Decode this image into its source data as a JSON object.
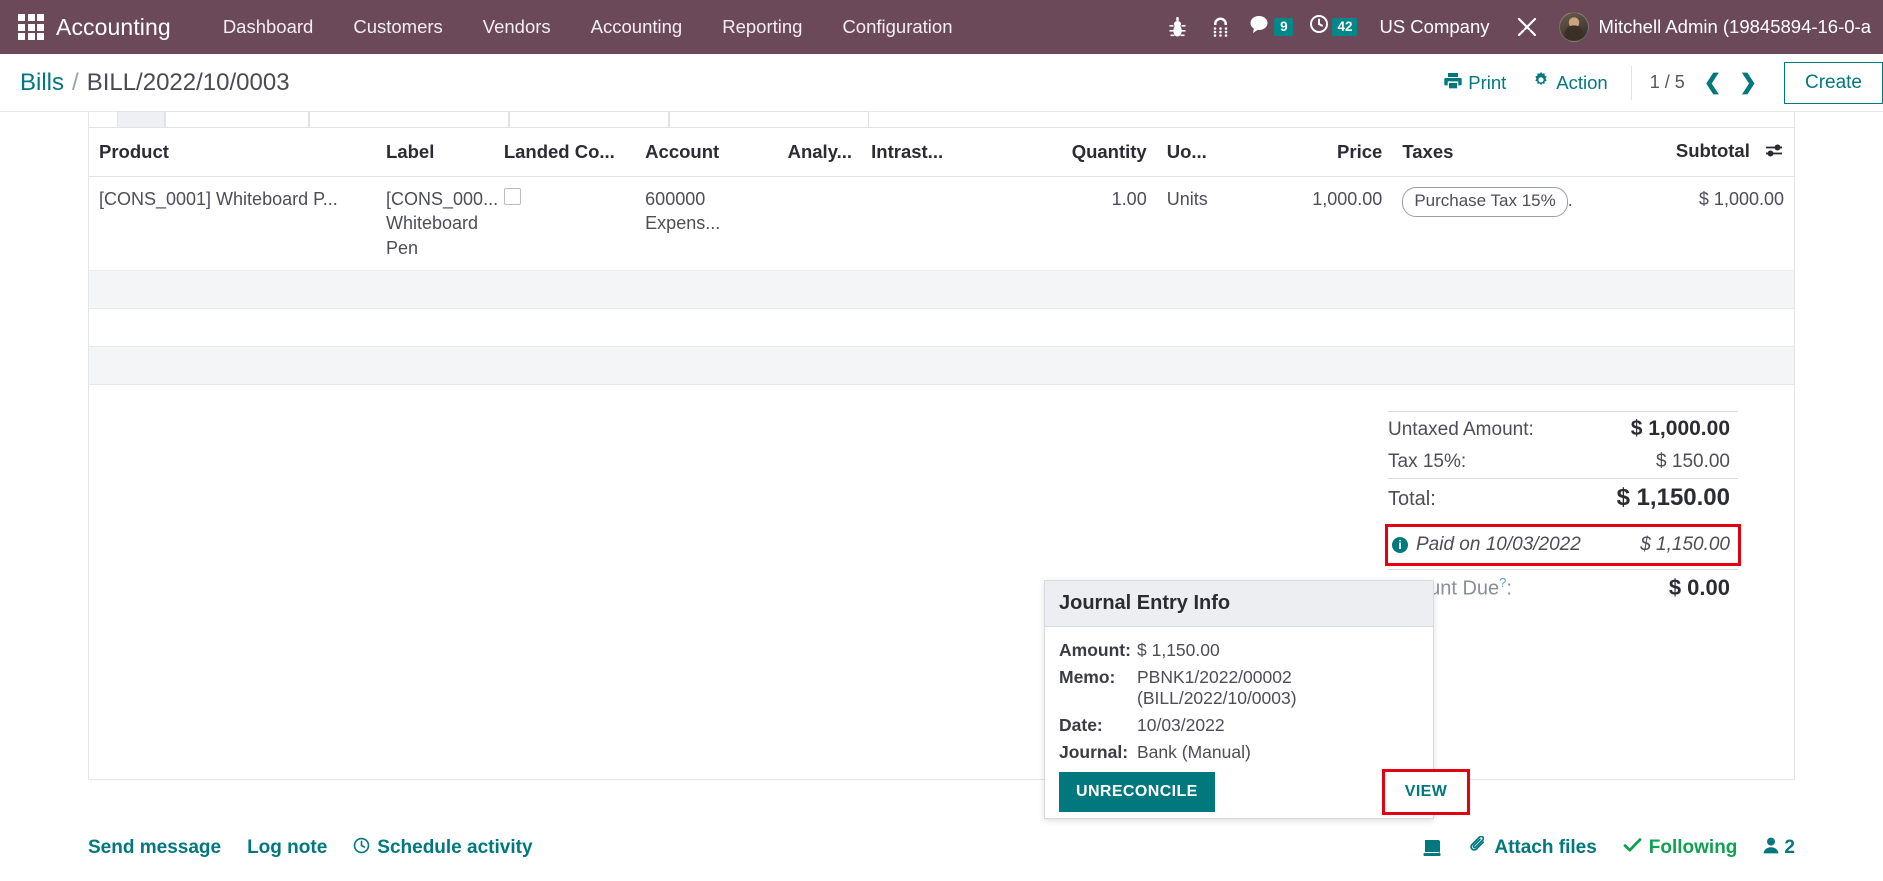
{
  "navbar": {
    "apps_icon": "apps-grid-icon",
    "brand": "Accounting",
    "menu": [
      {
        "label": "Dashboard"
      },
      {
        "label": "Customers"
      },
      {
        "label": "Vendors"
      },
      {
        "label": "Accounting"
      },
      {
        "label": "Reporting"
      },
      {
        "label": "Configuration"
      }
    ],
    "systray": {
      "bug_icon": "bug-icon",
      "phone_icon": "dialpad-icon",
      "messages_icon": "chat-bubble-icon",
      "messages_count": "9",
      "activities_icon": "clock-icon",
      "activities_count": "42",
      "company": "US Company",
      "tools_icon": "wrench-screwdriver-icon",
      "avatar": "user-avatar",
      "username": "Mitchell Admin (19845894-16-0-a"
    }
  },
  "control_panel": {
    "breadcrumb_root": "Bills",
    "breadcrumb_sep": "/",
    "breadcrumb_current": "BILL/2022/10/0003",
    "print_label": "Print",
    "print_icon": "printer-icon",
    "action_label": "Action",
    "action_icon": "gear-icon",
    "pager": "1 / 5",
    "prev_icon": "chevron-left-icon",
    "next_icon": "chevron-right-icon",
    "create_label": "Create"
  },
  "lines_table": {
    "columns": [
      {
        "label": "Product",
        "align": "left"
      },
      {
        "label": "Label",
        "align": "left"
      },
      {
        "label": "Landed Co...",
        "align": "left"
      },
      {
        "label": "Account",
        "align": "left"
      },
      {
        "label": "Analy...",
        "align": "left"
      },
      {
        "label": "Intrast...",
        "align": "left"
      },
      {
        "label": "Quantity",
        "align": "right"
      },
      {
        "label": "Uo...",
        "align": "left"
      },
      {
        "label": "Price",
        "align": "right"
      },
      {
        "label": "Taxes",
        "align": "left"
      },
      {
        "label": "Subtotal",
        "align": "right"
      }
    ],
    "settings_icon": "column-settings-icon",
    "rows": [
      {
        "product": "[CONS_0001] Whiteboard P...",
        "label": "[CONS_000... Whiteboard Pen",
        "landed_cost": "",
        "account": "600000 Expens...",
        "analytic": "",
        "intrastat": "",
        "quantity": "1.00",
        "uom": "Units",
        "price": "1,000.00",
        "taxes": "Purchase Tax 15%",
        "taxes_suffix": ".",
        "subtotal": "$ 1,000.00"
      }
    ]
  },
  "popover": {
    "title": "Journal Entry Info",
    "rows": [
      {
        "key": "Amount:",
        "value": "$ 1,150.00"
      },
      {
        "key": "Memo:",
        "value": "PBNK1/2022/00002 (BILL/2022/10/0003)"
      },
      {
        "key": "Date:",
        "value": "10/03/2022"
      },
      {
        "key": "Journal:",
        "value": "Bank (Manual)"
      }
    ],
    "unreconcile_label": "UNRECONCILE",
    "view_label": "VIEW"
  },
  "totals": {
    "untaxed_label": "Untaxed Amount:",
    "untaxed_value": "$ 1,000.00",
    "tax_label": "Tax 15%:",
    "tax_value": "$ 150.00",
    "total_label": "Total:",
    "total_value": "$ 1,150.00",
    "paid_icon": "info-icon",
    "paid_label": "Paid on 10/03/2022",
    "paid_value": "$ 1,150.00",
    "amount_due_label": "Amount Due",
    "amount_due_help": "?",
    "amount_due_colon": ":",
    "amount_due_value": "$ 0.00"
  },
  "chatter": {
    "send_message": "Send message",
    "log_note": "Log note",
    "schedule_activity": "Schedule activity",
    "schedule_icon": "clock-icon",
    "book_icon": "book-icon",
    "attach_icon": "paperclip-icon",
    "attach_files": "Attach files",
    "following_icon": "check-icon",
    "following": "Following",
    "followers_icon": "user-icon",
    "followers_count": "2"
  },
  "colors": {
    "navbar_bg": "#6b4959",
    "accent": "#00787e",
    "badge": "#00878a",
    "highlight": "#e3000f",
    "following_green": "#12a150"
  }
}
